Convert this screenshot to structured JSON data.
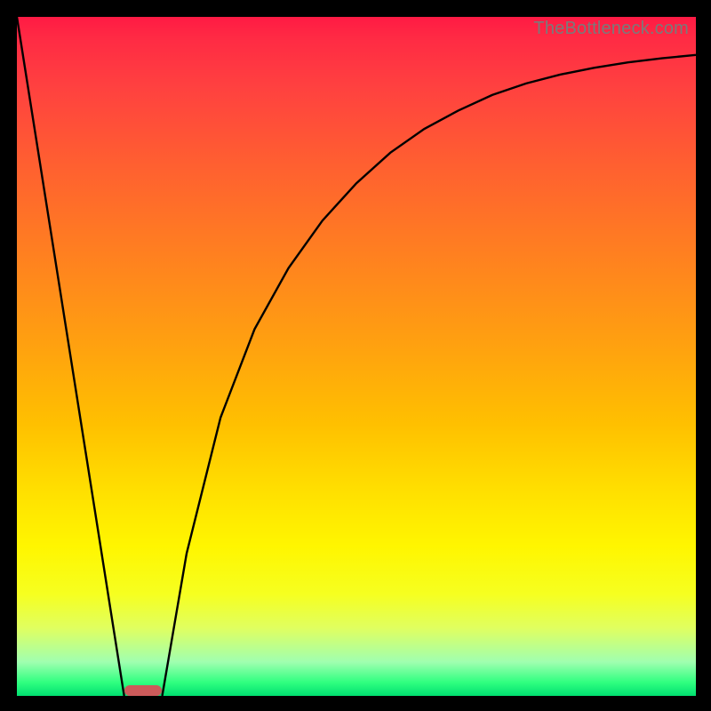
{
  "watermark": "TheBottleneck.com",
  "chart_data": {
    "type": "line",
    "title": "",
    "xlabel": "",
    "ylabel": "",
    "xlim": [
      0,
      1
    ],
    "ylim": [
      0,
      1
    ],
    "grid": false,
    "legend": false,
    "series": [
      {
        "name": "left-line",
        "x": [
          0.0,
          0.158
        ],
        "y": [
          1.0,
          0.0
        ]
      },
      {
        "name": "right-curve",
        "x": [
          0.214,
          0.25,
          0.3,
          0.35,
          0.4,
          0.45,
          0.5,
          0.55,
          0.6,
          0.65,
          0.7,
          0.75,
          0.8,
          0.85,
          0.9,
          0.95,
          1.0
        ],
        "y": [
          0.0,
          0.21,
          0.41,
          0.54,
          0.63,
          0.7,
          0.755,
          0.8,
          0.835,
          0.862,
          0.885,
          0.902,
          0.915,
          0.925,
          0.933,
          0.939,
          0.944
        ]
      }
    ],
    "marker": {
      "x_start": 0.158,
      "x_end": 0.214,
      "y": 0.0,
      "color": "#cc5a5a"
    },
    "background": "heat-gradient-red-to-green"
  }
}
